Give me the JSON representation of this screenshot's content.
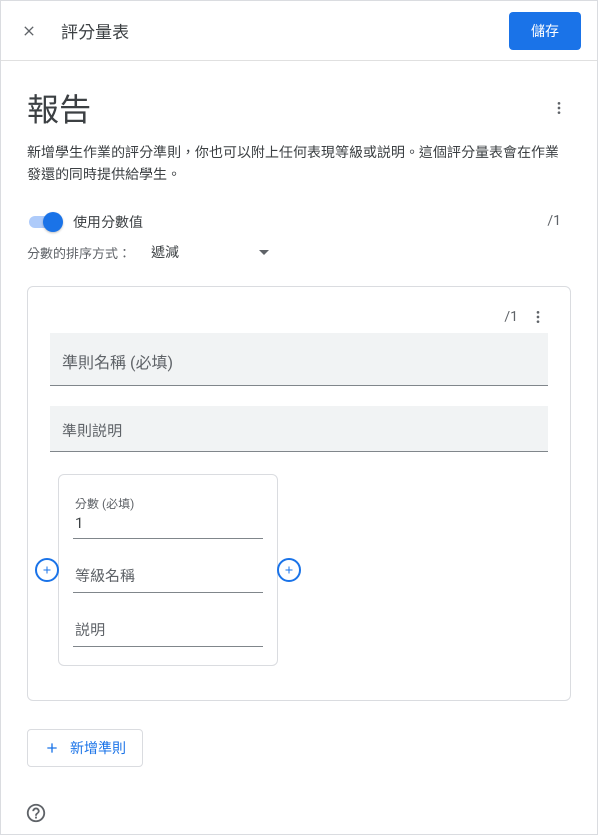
{
  "topbar": {
    "title": "評分量表",
    "save_label": "儲存"
  },
  "page": {
    "title": "報告",
    "description": "新增學生作業的評分準則，你也可以附上任何表現等級或説明。這個評分量表會在作業發還的同時提供給學生。"
  },
  "scoring": {
    "switch_label": "使用分數值",
    "sort_label": "分數的排序方式：",
    "sort_value": "遞減",
    "total_display": "/1"
  },
  "criterion": {
    "score_display": "/1",
    "name_placeholder": "準則名稱 (必填)",
    "desc_placeholder": "準則説明",
    "level": {
      "points_label": "分數 (必填)",
      "points_value": "1",
      "name_placeholder": "等級名稱",
      "desc_placeholder": "説明"
    }
  },
  "buttons": {
    "add_criterion": "新增準則"
  }
}
